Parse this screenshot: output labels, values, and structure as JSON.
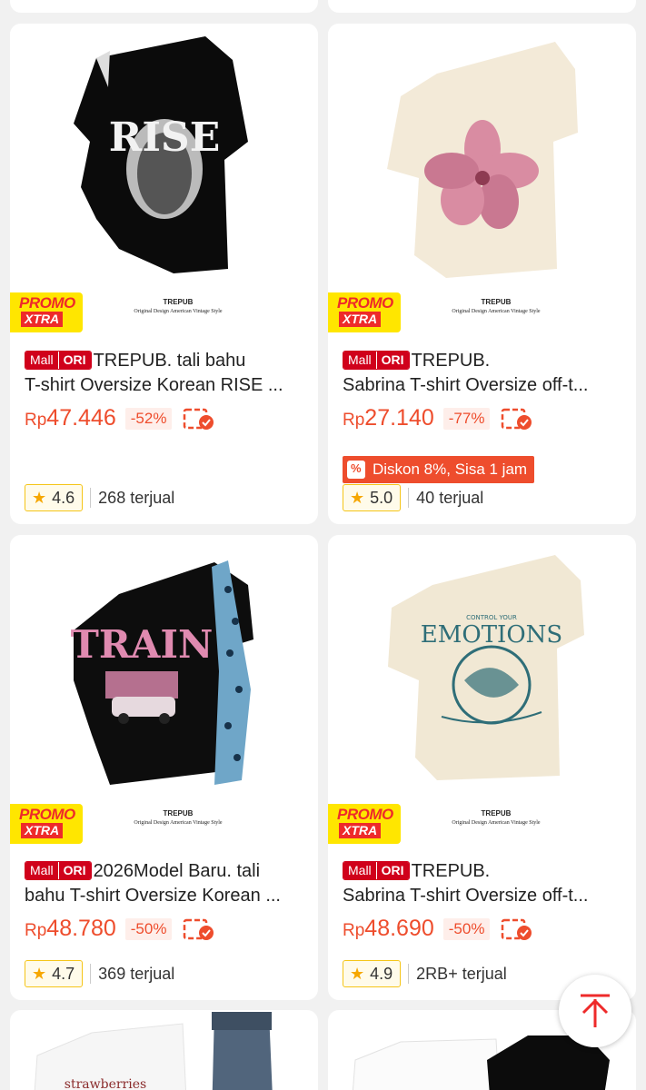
{
  "products": [
    {
      "badge_mall": "Mall",
      "badge_ori": "ORI",
      "title_line1": "TREPUB. tali bahu",
      "title_line2": "T-shirt Oversize Korean RISE ...",
      "price_currency": "Rp",
      "price_value": "47.446",
      "discount": "-52%",
      "rating": "4.6",
      "sold": "268 terjual",
      "promo_line1": "PROMO",
      "promo_line2": "XTRA",
      "brand_name": "TREPUB",
      "brand_tagline": "Original Design American Vintage Style",
      "print_text": "RISE"
    },
    {
      "badge_mall": "Mall",
      "badge_ori": "ORI",
      "title_line1": "TREPUB.",
      "title_line2": "Sabrina T-shirt Oversize off-t...",
      "price_currency": "Rp",
      "price_value": "27.140",
      "discount": "-77%",
      "flash_text": "Diskon 8%, Sisa 1 jam",
      "rating": "5.0",
      "sold": "40 terjual",
      "promo_line1": "PROMO",
      "promo_line2": "XTRA",
      "brand_name": "TREPUB",
      "brand_tagline": "Original Design American Vintage Style"
    },
    {
      "badge_mall": "Mall",
      "badge_ori": "ORI",
      "title_line1": "2026Model Baru. tali",
      "title_line2": "bahu T-shirt Oversize Korean ...",
      "price_currency": "Rp",
      "price_value": "48.780",
      "discount": "-50%",
      "rating": "4.7",
      "sold": "369 terjual",
      "promo_line1": "PROMO",
      "promo_line2": "XTRA",
      "brand_name": "TREPUB",
      "brand_tagline": "Original Design American Vintage Style",
      "print_text": "TRAIN"
    },
    {
      "badge_mall": "Mall",
      "badge_ori": "ORI",
      "title_line1": "TREPUB.",
      "title_line2": "Sabrina T-shirt Oversize off-t...",
      "price_currency": "Rp",
      "price_value": "48.690",
      "discount": "-50%",
      "rating": "4.9",
      "sold": "2RB+ terjual",
      "promo_line1": "PROMO",
      "promo_line2": "XTRA",
      "brand_name": "TREPUB",
      "brand_tagline": "Original Design American Vintage Style",
      "print_top": "CONTROL YOUR",
      "print_text": "EMOTIONS"
    }
  ],
  "partial_products": [
    {
      "print_text": "strawberries"
    },
    {}
  ],
  "colors": {
    "accent": "#ee4d2d",
    "mall_red": "#d0011b",
    "promo_yellow": "#ffe600",
    "star": "#f6a700"
  },
  "back_to_top_icon": "arrow-up-to-top-icon"
}
